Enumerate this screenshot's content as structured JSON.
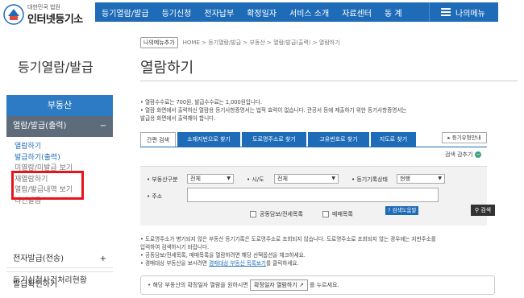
{
  "header": {
    "logo_small": "대한민국 법원",
    "logo_big": "인터넷등기소",
    "nav": [
      "등기열람/발급",
      "등기신청",
      "전자납부",
      "확정일자",
      "서비스 소개",
      "자료센터",
      "동 계"
    ],
    "my_menu": "나의메뉴",
    "colors": {
      "nav_bg": "#1e6bb8"
    }
  },
  "sidebar": {
    "title": "등기열람/발급",
    "section": "부동산",
    "active_group": "열람/발급(출력)",
    "active_toggle": "−",
    "items": [
      "열람하기",
      "발급하기(출력)",
      "미열람/미발급 보기",
      "재열람하기",
      "열람/발급내역 보기",
      "타인발급"
    ],
    "groups": [
      {
        "label": "전자발급(전송)",
        "toggle": "+"
      },
      {
        "label": "발급확인하기",
        "toggle": ""
      },
      {
        "label": "등기신청사건처리현황",
        "toggle": ""
      }
    ]
  },
  "breadcrumb": {
    "mymenu_add": "나의메뉴추가",
    "path": "HOME > 등기열람/발급 > 부동산 > 열람/발급(출력) > 열람하기"
  },
  "page": {
    "title": "열람하기",
    "notes": [
      "• 열람수수료는 700원, 발급수수료는 1,000원입니다.",
      "• 열람 화면에서 출력하신 열람용 등기사항증명서는 법적 효력이 없습니다. 관공서 등에 제출하기 위한 등기사항증명서는",
      "   발급용 화면에서 출력해야 합니다."
    ]
  },
  "tabs": {
    "items": [
      "간편 검색",
      "소재지번으로 찾기",
      "도로명주소로 찾기",
      "고유번호로 찾기",
      "지도로 찾기"
    ],
    "active_index": 0,
    "help": "▸ 등기유형안내",
    "fold": "검색 감추기"
  },
  "form": {
    "label_type": "• 부동산구분",
    "value_type": "전체",
    "label_city": "• 시/도",
    "value_city": "전체",
    "label_status": "• 등기기록상태",
    "value_status": "현행",
    "label_address": "• 주소",
    "address_value": "",
    "check1": "공동담보/전세목록",
    "check2": "매매목록",
    "map_button": "검색도움말",
    "search_button": "검색"
  },
  "notes2": {
    "line1": "• 도로명주소가 병기되지 않은 부동산 등기기록은 도로명주소로 조회되지 않습니다. 도로명주소로 조회되지 않는 경우에는 지번주소를",
    "line2": "   입력하여 검색하시기 바랍니다.",
    "line3": "• 공동담보/전세목록, 매매목록을 열람하려면 해당 선택옵션을 체크하세요.",
    "line4_pre": "• 경매대상 부동산을 보시려면 ",
    "line4_link": "경매대상 부동산 목록보기",
    "line4_post": "를 클릭하세요."
  },
  "bottom": {
    "pre": "• 해당 부동산의 확정일자 열람을 원하시면 ",
    "button": "확정일자 열람하기 ↗",
    "post": " 를 누르세요."
  }
}
